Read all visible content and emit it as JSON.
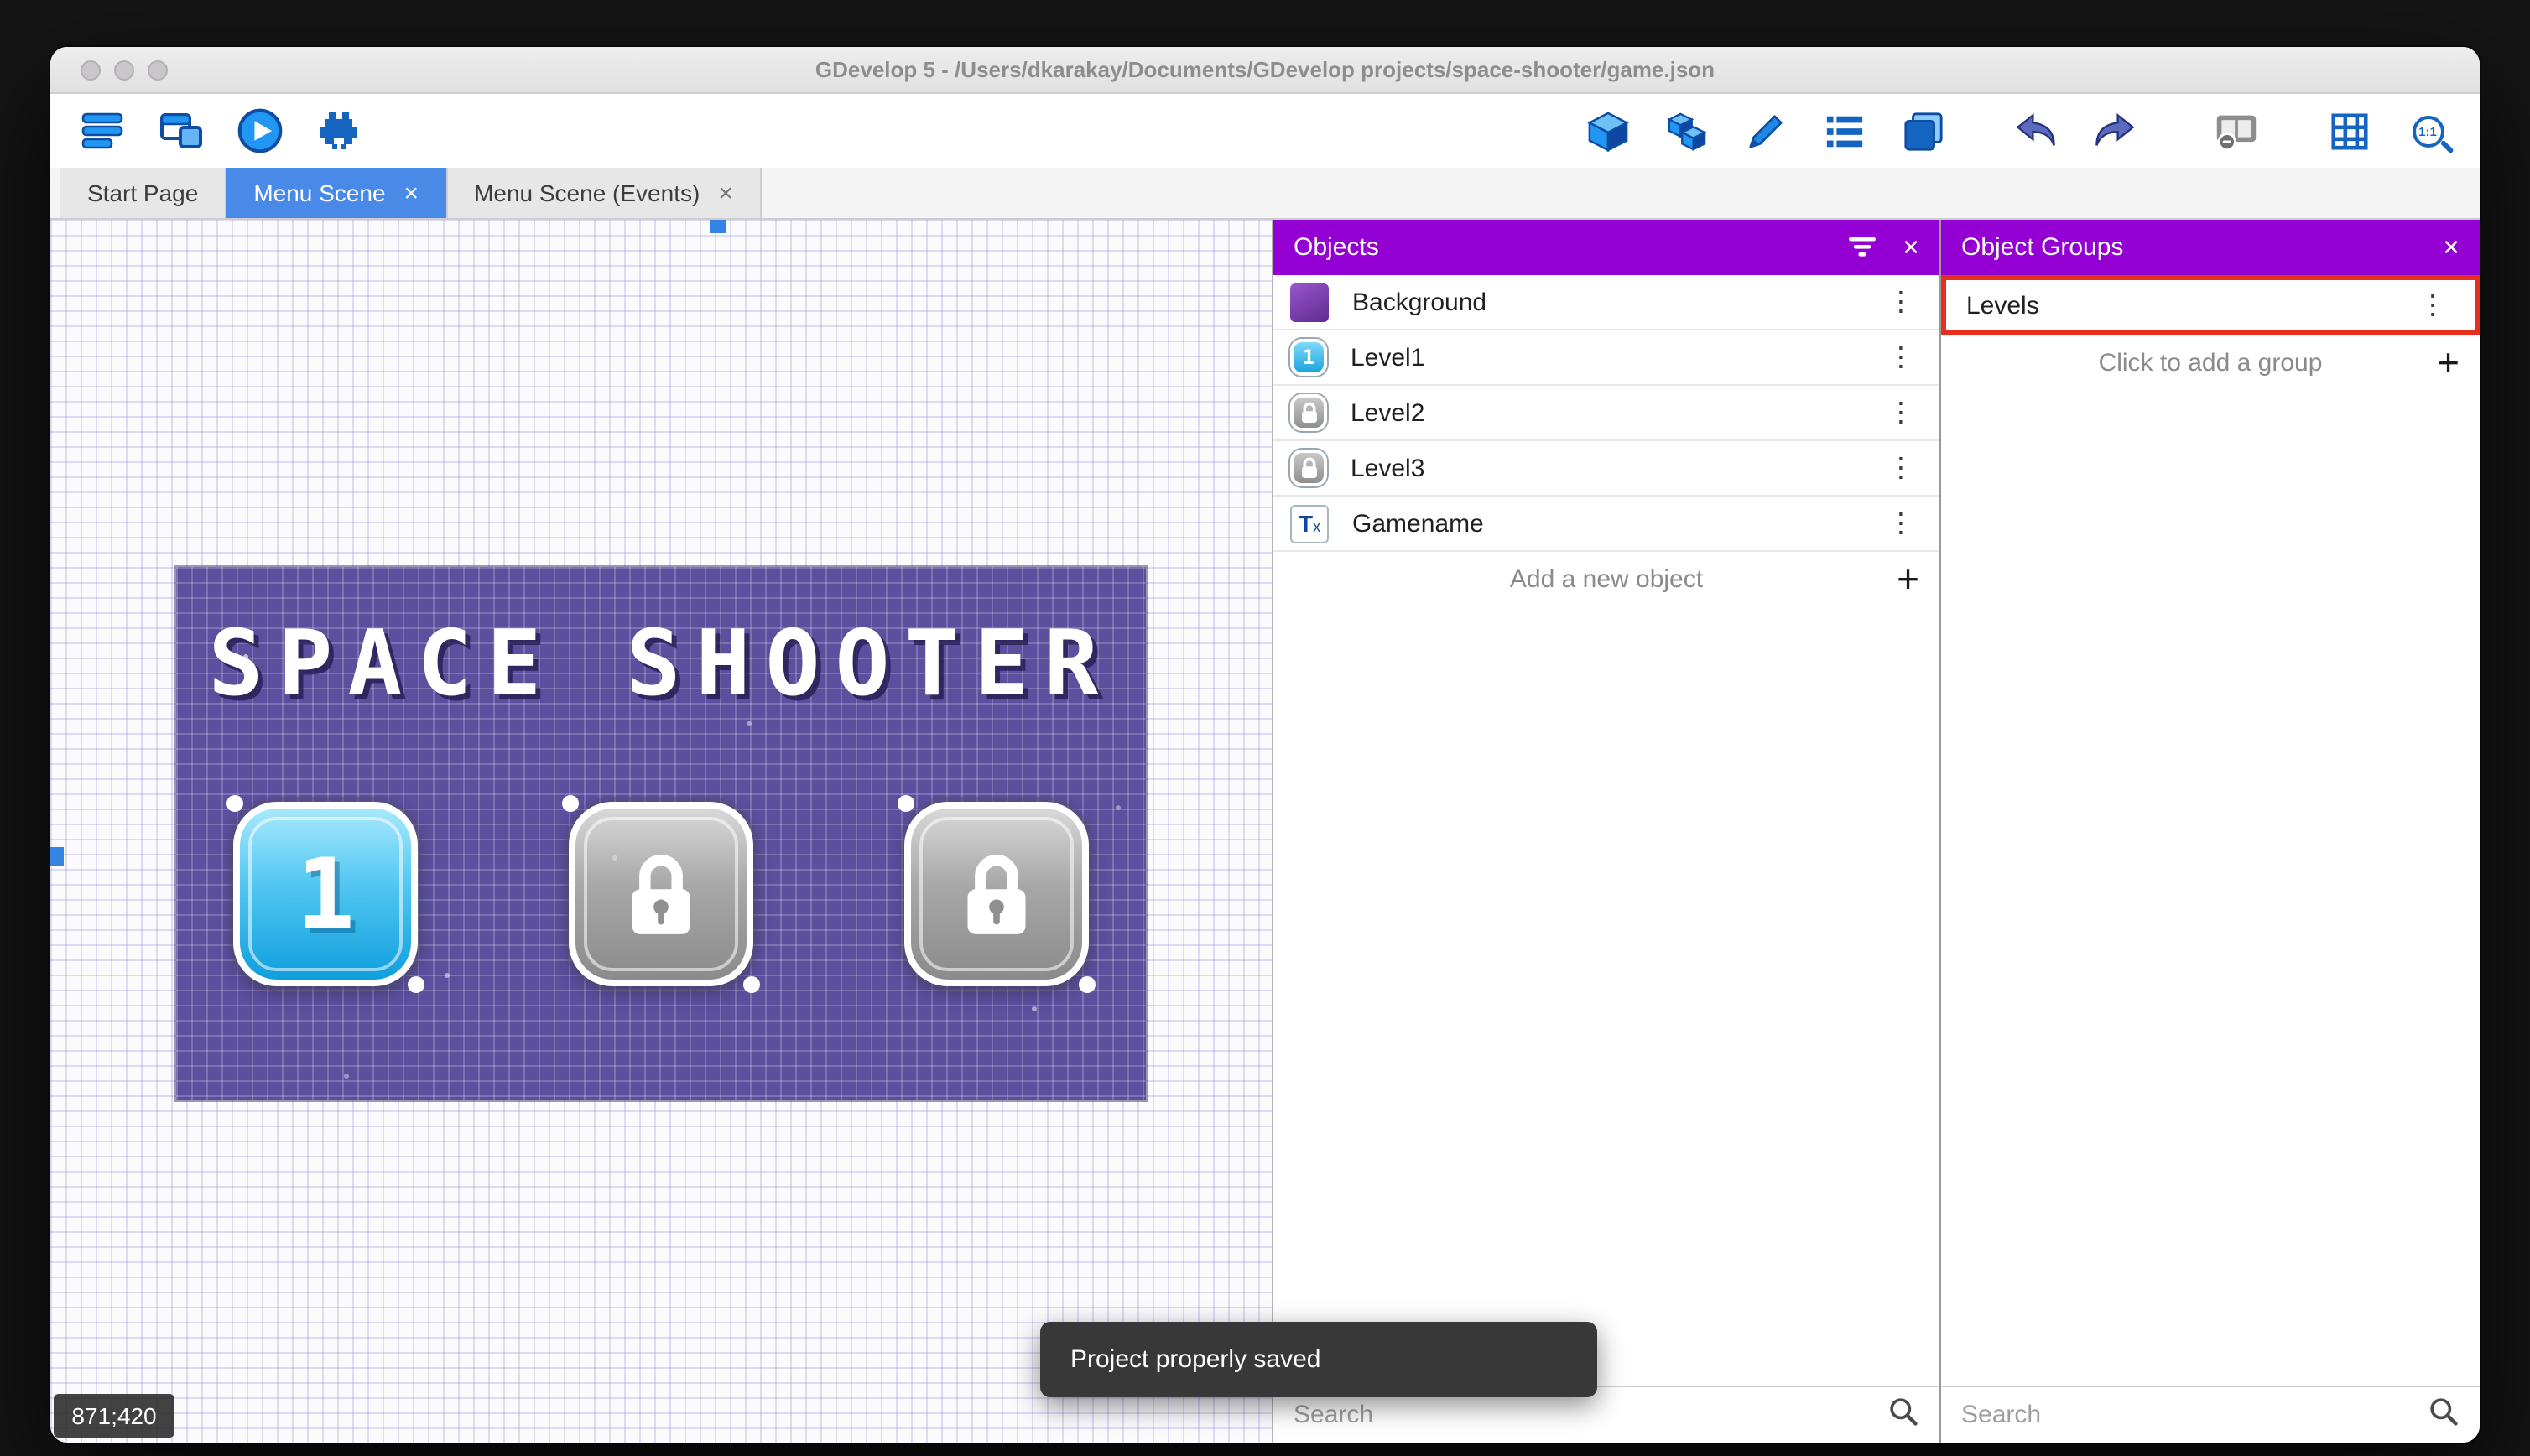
{
  "window": {
    "title": "GDevelop 5 - /Users/dkarakay/Documents/GDevelop projects/space-shooter/game.json",
    "traffic_lights": [
      "close",
      "minimize",
      "zoom"
    ]
  },
  "toolbar": {
    "left_icons": [
      "project-manager",
      "scene-editor",
      "play-preview",
      "debug"
    ],
    "right_icons": [
      "objects-editor",
      "object-groups-editor",
      "properties",
      "instances-list",
      "layers-editor",
      "undo",
      "redo",
      "preview-options",
      "grid",
      "zoom-1-1"
    ],
    "zoom_label": "1:1"
  },
  "tabs": [
    {
      "label": "Start Page",
      "active": false,
      "closable": false
    },
    {
      "label": "Menu Scene",
      "active": true,
      "closable": true
    },
    {
      "label": "Menu Scene (Events)",
      "active": false,
      "closable": true
    }
  ],
  "canvas": {
    "scene": {
      "title": "SPACE SHOOTER",
      "buttons": [
        {
          "label": "1",
          "state": "unlocked"
        },
        {
          "label": "lock",
          "state": "locked"
        },
        {
          "label": "lock",
          "state": "locked"
        }
      ]
    },
    "coordinates": "871;420"
  },
  "objects_panel": {
    "title": "Objects",
    "header_icons": [
      "filter",
      "close"
    ],
    "items": [
      {
        "name": "Background",
        "icon": "purple-swatch"
      },
      {
        "name": "Level1",
        "icon": "level-button-unlocked",
        "icon_label": "1"
      },
      {
        "name": "Level2",
        "icon": "level-button-locked"
      },
      {
        "name": "Level3",
        "icon": "level-button-locked"
      },
      {
        "name": "Gamename",
        "icon": "text-object",
        "icon_label": "T",
        "icon_sub": "x"
      }
    ],
    "add_button": "Add a new object",
    "search_placeholder": "Search"
  },
  "groups_panel": {
    "title": "Object Groups",
    "header_icons": [
      "close"
    ],
    "groups": [
      {
        "name": "Levels",
        "highlighted": true
      }
    ],
    "add_button": "Click to add a group",
    "search_placeholder": "Search"
  },
  "toast": {
    "message": "Project properly saved"
  },
  "colors": {
    "panel_header": "#9400d3",
    "active_tab": "#4989e8",
    "highlight_border": "#e62f1e",
    "scene_background": "#5b4f9e",
    "toast_background": "#383838",
    "accent_blue": "#1e88e5"
  }
}
